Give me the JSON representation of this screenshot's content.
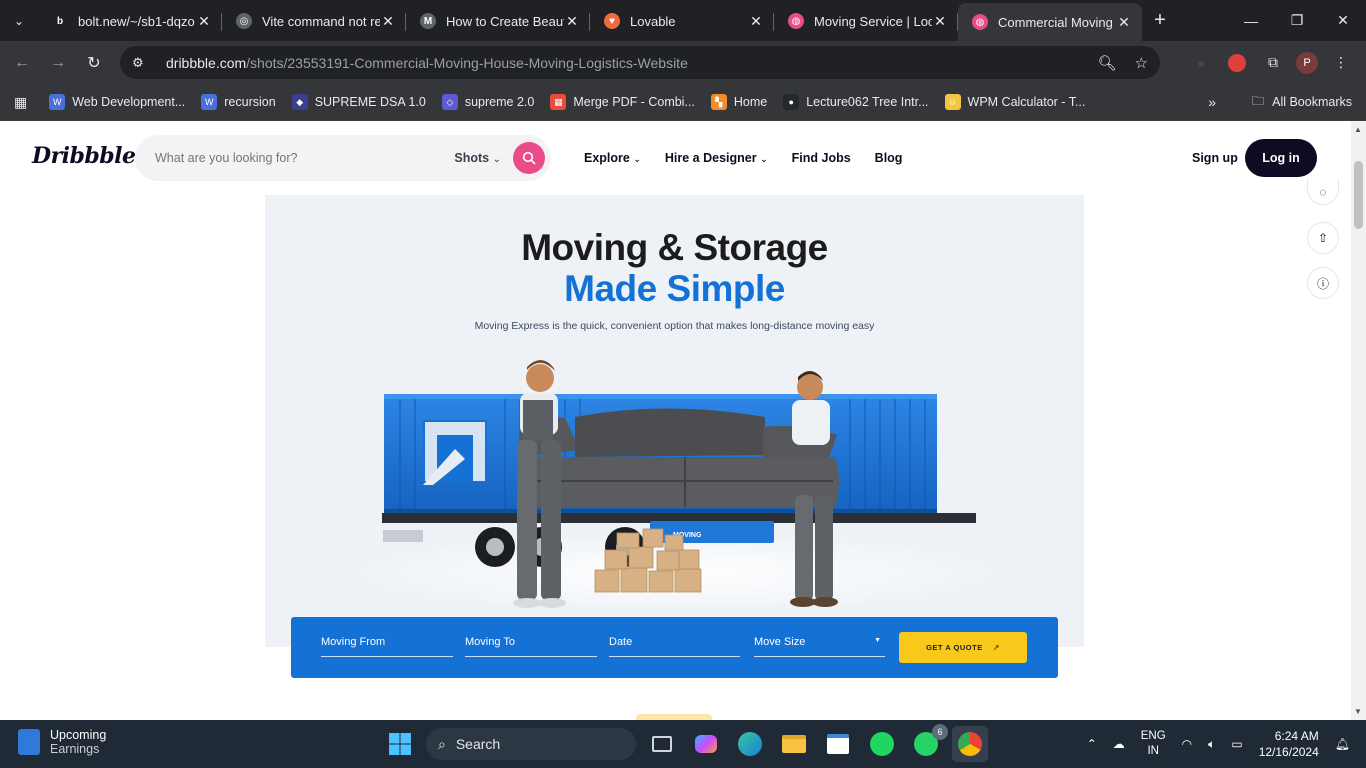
{
  "browser": {
    "tabs": [
      {
        "title": "bolt.new/~/sb1-dqzo",
        "favicon_color": "#202124",
        "favicon_glyph": "b",
        "active": false
      },
      {
        "title": "Vite command not re",
        "favicon_color": "#5f6368",
        "favicon_glyph": "◎",
        "active": false
      },
      {
        "title": "How to Create Beauti",
        "favicon_color": "#5f6368",
        "favicon_glyph": "M",
        "active": false
      },
      {
        "title": "Lovable",
        "favicon_color": "#f06b3c",
        "favicon_glyph": "♥",
        "active": false
      },
      {
        "title": "Moving Service | Loca",
        "favicon_color": "#ea4c89",
        "favicon_glyph": "◍",
        "active": false
      },
      {
        "title": "Commercial Moving",
        "favicon_color": "#ea4c89",
        "favicon_glyph": "◍",
        "active": true
      }
    ],
    "url_host": "dribbble.com",
    "url_path": "/shots/23553191-Commercial-Moving-House-Moving-Logistics-Website",
    "profile_initial": "P",
    "bookmarks": [
      {
        "label": "Web Development...",
        "color": "#4a6fdc",
        "glyph": "W"
      },
      {
        "label": "recursion",
        "color": "#4a6fdc",
        "glyph": "W"
      },
      {
        "label": "SUPREME DSA 1.0",
        "color": "#3b3f8f",
        "glyph": "◆"
      },
      {
        "label": "supreme 2.0",
        "color": "#5b5bd6",
        "glyph": "◇"
      },
      {
        "label": "Merge PDF - Combi...",
        "color": "#e74c3c",
        "glyph": "▦"
      },
      {
        "label": "Home",
        "color": "#f28c28",
        "glyph": "▚"
      },
      {
        "label": "Lecture062 Tree Intr...",
        "color": "#24292e",
        "glyph": "●"
      },
      {
        "label": "WPM Calculator - T...",
        "color": "#f4c542",
        "glyph": "☺"
      }
    ],
    "all_bookmarks_label": "All Bookmarks"
  },
  "dribbble": {
    "logo": "Dribbble",
    "search_placeholder": "What are you looking for?",
    "search_scope": "Shots",
    "nav": [
      "Explore",
      "Hire a Designer",
      "Find Jobs",
      "Blog"
    ],
    "signup": "Sign up",
    "login": "Log in"
  },
  "shot": {
    "headline_line1": "Moving & Storage",
    "headline_line2": "Made Simple",
    "subtext": "Moving Express is the quick, convenient option that makes long-distance moving easy",
    "container_brand": "MOVING",
    "booking": {
      "moving_from": "Moving From",
      "moving_to": "Moving To",
      "date": "Date",
      "move_size": "Move Size",
      "cta": "GET A QUOTE"
    },
    "colors": {
      "brand_blue": "#1471d6",
      "cta_yellow": "#f8c91a",
      "dribbble_pink": "#ea4c89"
    }
  },
  "taskbar": {
    "widget_title": "Upcoming",
    "widget_sub": "Earnings",
    "search_label": "Search",
    "whatsapp_badge": "6",
    "lang_line1": "ENG",
    "lang_line2": "IN",
    "time": "6:24 AM",
    "date": "12/16/2024"
  }
}
